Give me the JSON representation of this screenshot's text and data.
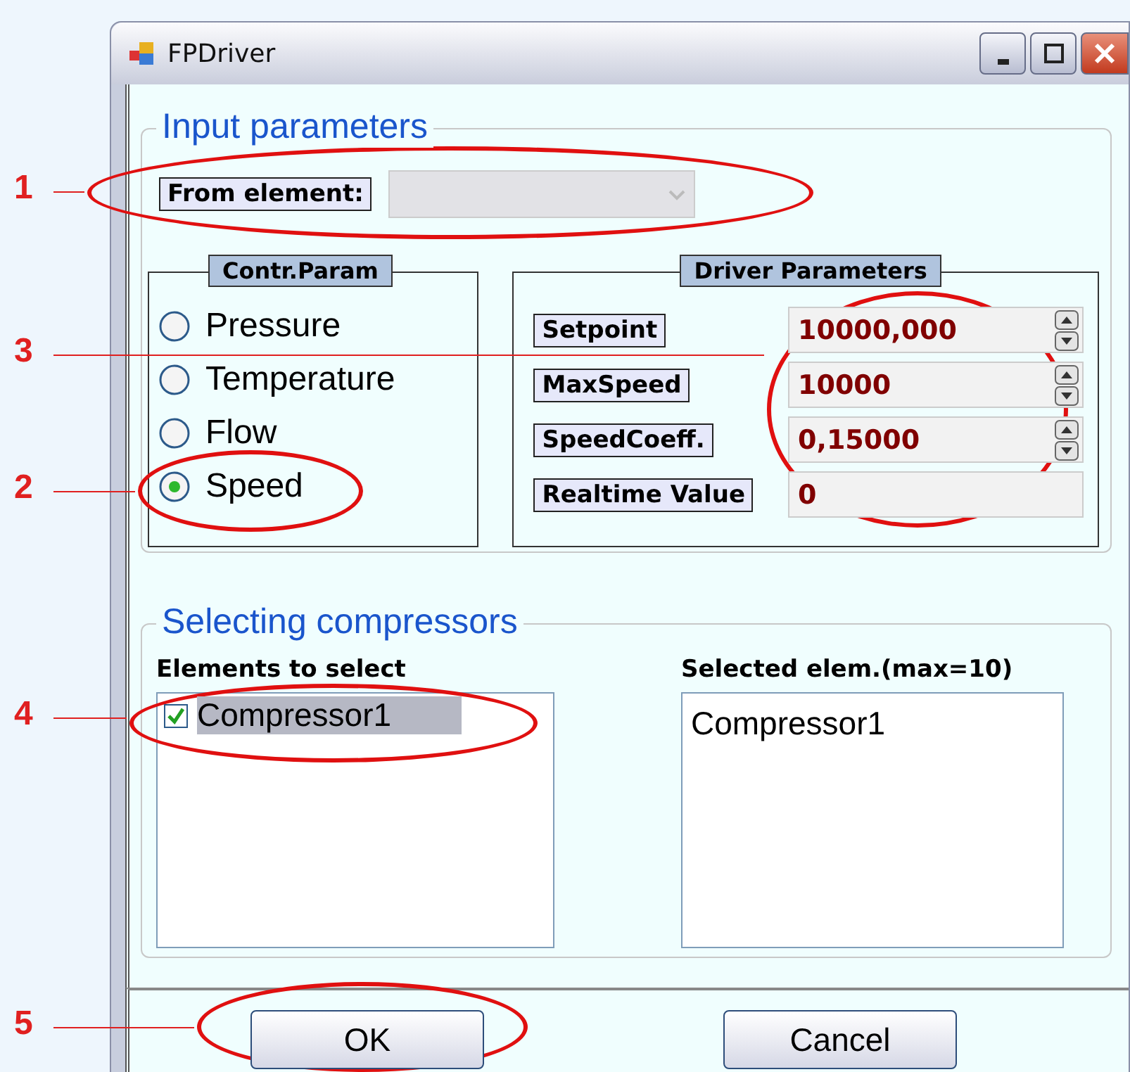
{
  "window": {
    "title": "FPDriver"
  },
  "input_parameters": {
    "title": "Input parameters",
    "from_element": {
      "label": "From element:",
      "disabled": true
    }
  },
  "contr_param": {
    "title": "Contr.Param",
    "options": [
      {
        "label": "Pressure",
        "selected": false
      },
      {
        "label": "Temperature",
        "selected": false
      },
      {
        "label": "Flow",
        "selected": false
      },
      {
        "label": "Speed",
        "selected": true
      }
    ]
  },
  "driver_parameters": {
    "title": "Driver Parameters",
    "fields": [
      {
        "label": "Setpoint",
        "value": "10000,000",
        "kind": "spin"
      },
      {
        "label": "MaxSpeed",
        "value": "10000",
        "kind": "spin"
      },
      {
        "label": "SpeedCoeff.",
        "value": "0,15000",
        "kind": "spin"
      },
      {
        "label": "Realtime Value",
        "value": "0",
        "kind": "readonly"
      }
    ]
  },
  "selecting_compressors": {
    "title": "Selecting compressors",
    "available": {
      "label": "Elements to select",
      "items": [
        {
          "label": "Compressor1",
          "checked": true,
          "selected": true
        }
      ]
    },
    "chosen": {
      "label": "Selected elem.(max=10)",
      "items": [
        {
          "label": "Compressor1"
        }
      ]
    }
  },
  "buttons": [
    {
      "label": "OK"
    },
    {
      "label": "Cancel"
    }
  ],
  "annotations": [
    {
      "label": "1"
    },
    {
      "label": "3"
    },
    {
      "label": "2"
    },
    {
      "label": "4"
    },
    {
      "label": "5"
    }
  ]
}
